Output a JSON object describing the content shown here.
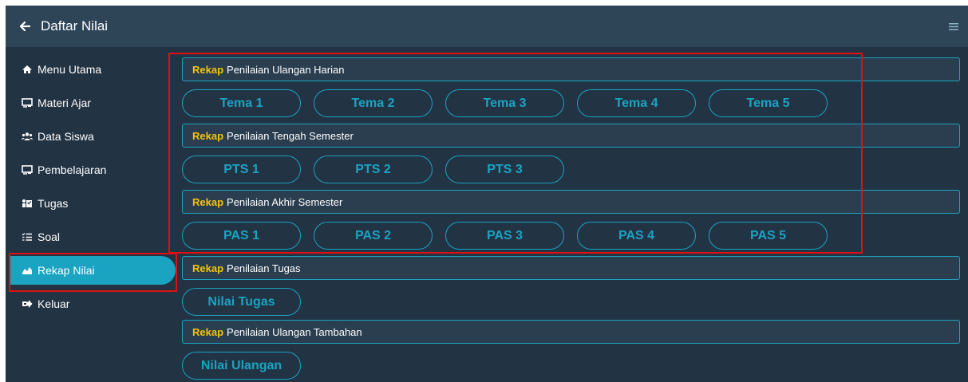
{
  "header": {
    "title": "Daftar Nilai",
    "back_icon": "arrow-left-icon",
    "menu_icon": "hamburger-menu-icon"
  },
  "sidebar": {
    "items": [
      {
        "label": "Menu Utama",
        "icon": "home-icon"
      },
      {
        "label": "Materi Ajar",
        "icon": "chalkboard-icon"
      },
      {
        "label": "Data Siswa",
        "icon": "users-icon"
      },
      {
        "label": "Pembelajaran",
        "icon": "chalkboard-icon"
      },
      {
        "label": "Tugas",
        "icon": "tasks-icon"
      },
      {
        "label": "Soal",
        "icon": "list-icon"
      },
      {
        "label": "Rekap Nilai",
        "icon": "chart-area-icon",
        "active": true
      },
      {
        "label": "Keluar",
        "icon": "sign-out-icon"
      }
    ]
  },
  "sections": [
    {
      "rekap": "Rekap",
      "title": "Penilaian Ulangan Harian",
      "buttons": [
        "Tema 1",
        "Tema 2",
        "Tema 3",
        "Tema 4",
        "Tema 5"
      ]
    },
    {
      "rekap": "Rekap",
      "title": "Penilaian Tengah Semester",
      "buttons": [
        "PTS 1",
        "PTS 2",
        "PTS 3"
      ]
    },
    {
      "rekap": "Rekap",
      "title": "Penilaian Akhir Semester",
      "buttons": [
        "PAS 1",
        "PAS 2",
        "PAS 3",
        "PAS 4",
        "PAS 5"
      ]
    },
    {
      "rekap": "Rekap",
      "title": "Penilaian Tugas",
      "buttons": [
        "Nilai Tugas"
      ]
    },
    {
      "rekap": "Rekap",
      "title": "Penilaian Ulangan Tambahan",
      "buttons": [
        "Nilai Ulangan"
      ]
    }
  ],
  "colors": {
    "background": "#223344",
    "topbar": "#2e4558",
    "accent": "#1ba3c2",
    "rekap": "#f4c20d",
    "highlight": "#e01010"
  }
}
